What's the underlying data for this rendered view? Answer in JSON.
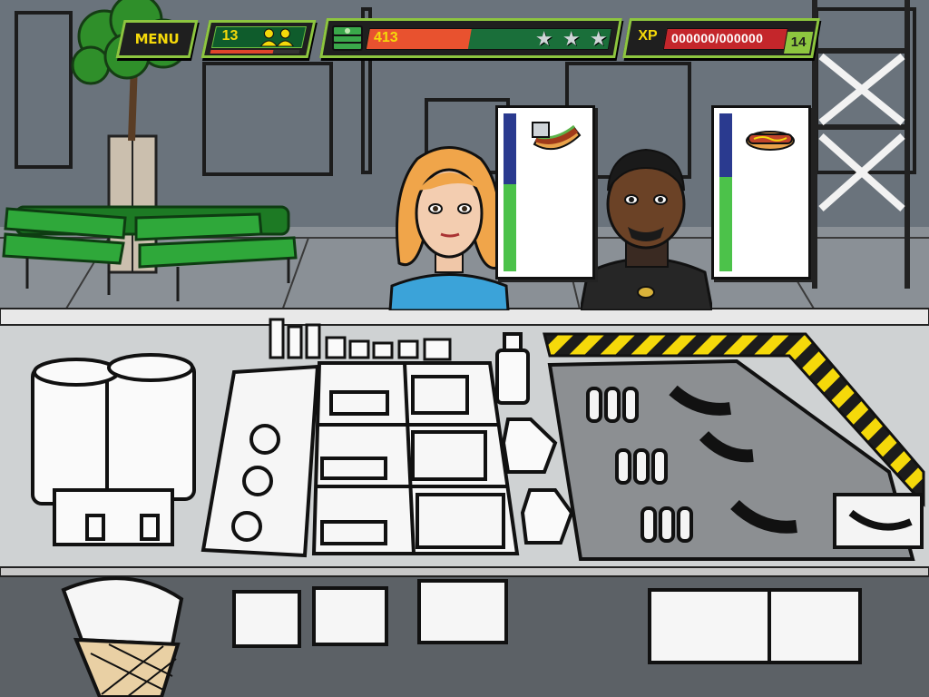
{
  "hud": {
    "menu_label": "MENU",
    "customers_served": "13",
    "customers_progress": 0.7,
    "cash": "413",
    "cash_progress": 0.42,
    "stars": 3,
    "xp_label": "XP",
    "xp_value": "000000/000000",
    "level": "14"
  },
  "icons": {
    "customers": "people-icon",
    "cash": "cash-stack-icon",
    "goal": "star-icon"
  },
  "customers": [
    {
      "name": "blonde-woman",
      "order": "loaded-hotdog",
      "patience": 0.55
    },
    {
      "name": "man-black-jacket",
      "order": "plain-hotdog",
      "patience": 0.6
    }
  ],
  "colors": {
    "hud_border": "#8dc63f",
    "hud_text": "#f5d90a",
    "cash_fill": "#e8522f",
    "xp_fill": "#c4262b",
    "patience_full": "#4cc24a",
    "patience_empty": "#2a3a8f"
  }
}
